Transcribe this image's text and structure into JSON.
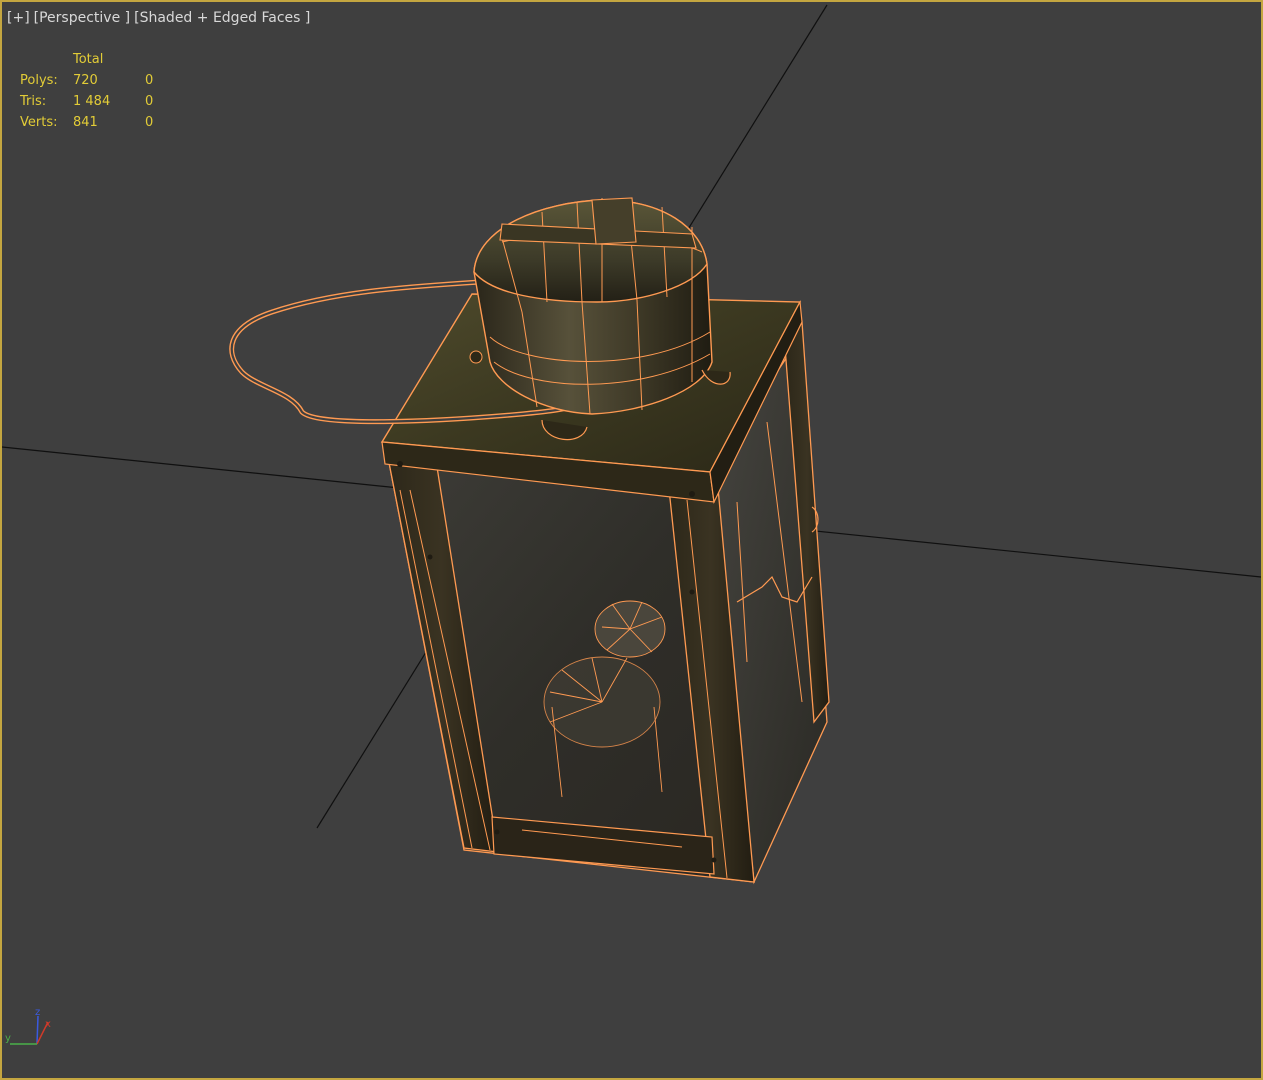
{
  "viewport": {
    "label": {
      "plus": "[+]",
      "view": "[Perspective ]",
      "shading": "[Shaded + Edged Faces ]"
    },
    "active_border_color": "#c4a640",
    "background_color": "#3f3f3f"
  },
  "stats": {
    "header": "Total",
    "rows": [
      {
        "label": "Polys:",
        "total": "720",
        "selected": "0"
      },
      {
        "label": "Tris:",
        "total": "1 484",
        "selected": "0"
      },
      {
        "label": "Verts:",
        "total": "841",
        "selected": "0"
      }
    ],
    "text_color": "#e2cc37"
  },
  "model": {
    "name": "lantern",
    "wire_color": "#ff9a52",
    "selected": true
  },
  "axis_gizmo": {
    "x_label": "x",
    "y_label": "y",
    "z_label": "z",
    "x_color": "#d03a2a",
    "y_color": "#4ab04a",
    "z_color": "#3a5ae0"
  }
}
